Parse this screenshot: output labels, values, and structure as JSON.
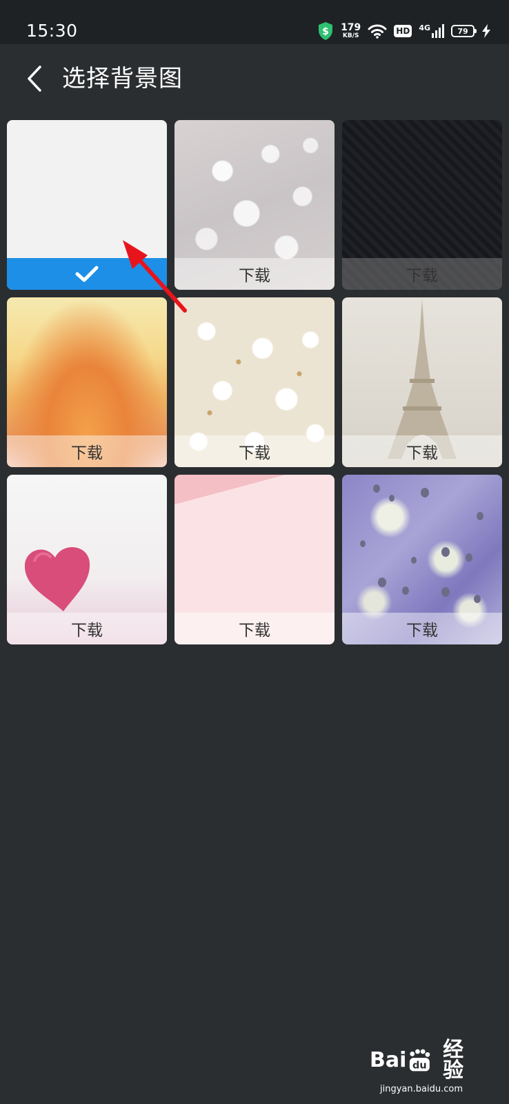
{
  "status_bar": {
    "time": "15:30",
    "net_speed": "179",
    "net_speed_unit": "KB/S",
    "hd_label": "HD",
    "network_type": "4G",
    "battery_level": "79"
  },
  "header": {
    "title": "选择背景图",
    "back_icon": "chevron-left-icon"
  },
  "backgrounds": [
    {
      "name": "white",
      "state": "selected",
      "label": ""
    },
    {
      "name": "bokeh",
      "state": "download",
      "label": "下载"
    },
    {
      "name": "dark",
      "state": "download",
      "label": "下载"
    },
    {
      "name": "gold-glitter",
      "state": "download",
      "label": "下载"
    },
    {
      "name": "flowers",
      "state": "download",
      "label": "下载"
    },
    {
      "name": "eiffel-tower",
      "state": "download",
      "label": "下载"
    },
    {
      "name": "heart",
      "state": "download",
      "label": "下载"
    },
    {
      "name": "pink-paper",
      "state": "download",
      "label": "下载"
    },
    {
      "name": "rain-drops",
      "state": "download",
      "label": "下载"
    }
  ],
  "colors": {
    "background": "#2b2e30",
    "status_bar": "#1f2224",
    "selected_accent": "#1e8fe6",
    "annotation_arrow": "#e8141c"
  },
  "watermark": {
    "logo_text_left": "Bai",
    "logo_text_right": "经验",
    "url": "jingyan.baidu.com"
  }
}
